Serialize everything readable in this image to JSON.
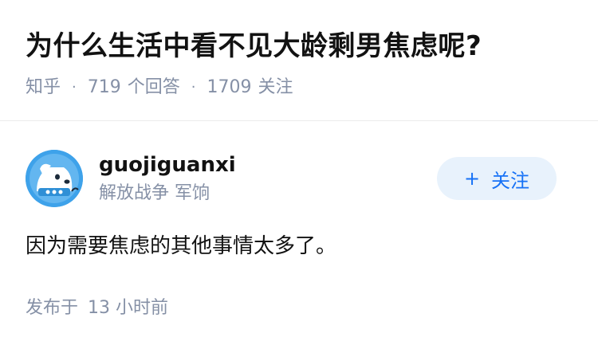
{
  "question": {
    "title": "为什么生活中看不见大龄剩男焦虑呢?",
    "source": "知乎",
    "answers_count": "719",
    "answers_label": "个回答",
    "followers_count": "1709",
    "followers_label": "关注"
  },
  "author": {
    "name": "guojiguanxi",
    "bio": "解放战争 军饷",
    "avatar_icon": "blue-dog-avatar"
  },
  "follow_button": {
    "icon": "+",
    "label": "关注"
  },
  "answer": {
    "content": "因为需要焦虑的其他事情太多了。",
    "published_label": "发布于",
    "published_time": "13 小时前"
  },
  "colors": {
    "accent": "#1772f6",
    "follow_bg": "#e8f2fc",
    "meta_gray": "#8590a6",
    "avatar_bg": "#3ea2ea"
  }
}
